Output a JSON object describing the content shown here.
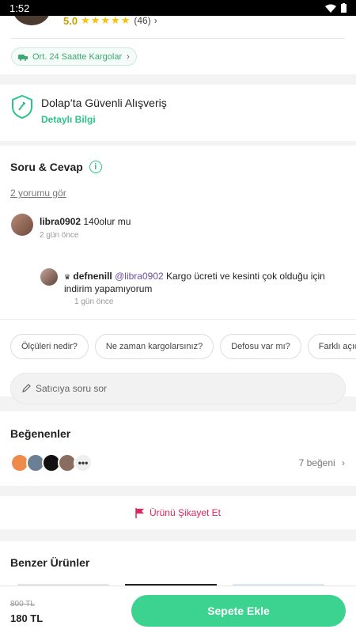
{
  "status_bar": {
    "time": "1:52"
  },
  "seller": {
    "rating": "5.0",
    "stars": "★★★★★",
    "rating_count": "(46)",
    "cargo_pill": "Ort. 24 Saatte Kargolar"
  },
  "safe_shopping": {
    "title": "Dolap’ta Güvenli Alışveriş",
    "link": "Detaylı Bilgi"
  },
  "qa": {
    "title": "Soru & Cevap",
    "see_comments": "2 yorumu gör",
    "comments": [
      {
        "user": "libra0902",
        "text": " 140olur mu",
        "time": "2 gün önce"
      },
      {
        "user": "defnenill",
        "mention": "@libra0902",
        "text": " Kargo ücreti ve kesinti çok olduğu için indirim yapamıyorum",
        "time": "1 gün önce"
      }
    ],
    "chips": [
      "Ölçüleri nedir?",
      "Ne zaman kargolarsınız?",
      "Defosu var mı?",
      "Farklı açıdan fotoğ"
    ],
    "ask_placeholder": "Satıcıya soru sor"
  },
  "likes": {
    "title": "Beğenenler",
    "count": "7 beğeni",
    "more": "•••"
  },
  "report": {
    "label": "Ürünü Şikayet Et"
  },
  "similar": {
    "title": "Benzer Ürünler"
  },
  "bottom": {
    "old_price": "800 TL",
    "price": "180 TL",
    "add_to_cart": "Sepete Ekle"
  },
  "colors": {
    "accent_green": "#3bd38f",
    "link_green": "#2cc38a",
    "report_red": "#e0245e",
    "star_yellow": "#f4c20d"
  }
}
